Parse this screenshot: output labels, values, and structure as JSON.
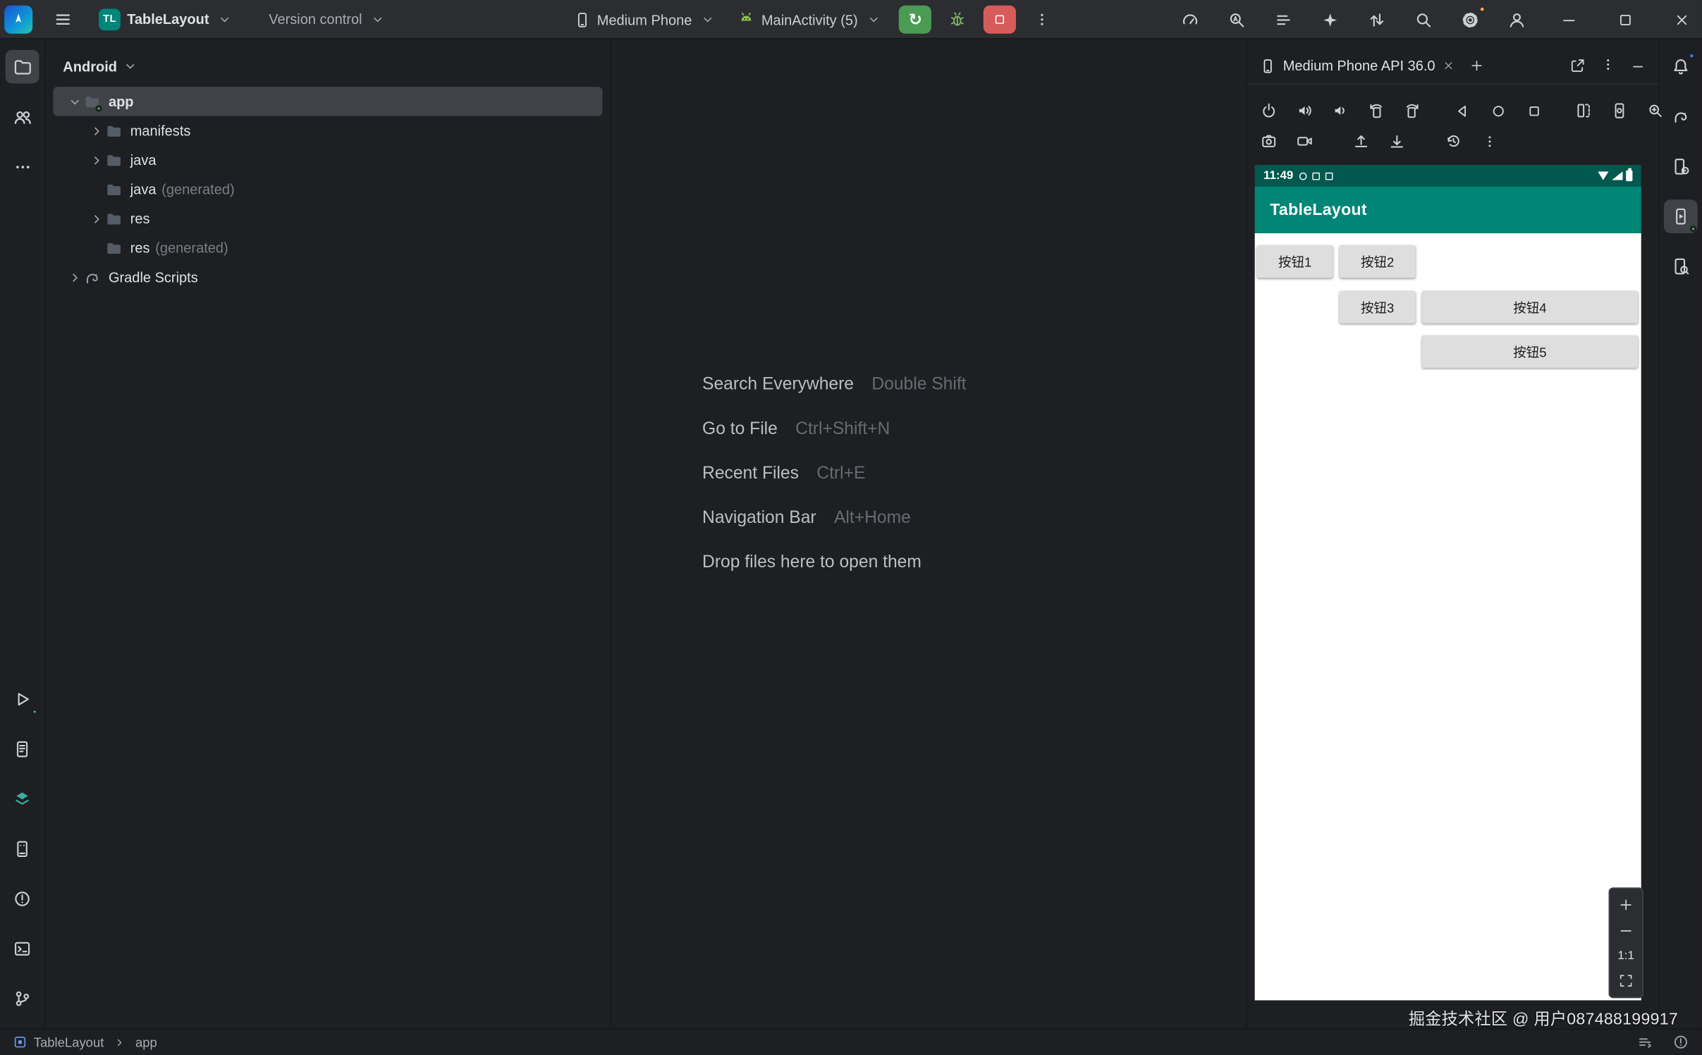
{
  "titlebar": {
    "project_abbr": "TL",
    "project_name": "TableLayout",
    "version_control_label": "Version control",
    "device_selector": "Medium Phone",
    "run_config": "MainActivity (5)"
  },
  "project_panel": {
    "view_selector": "Android",
    "items": [
      {
        "label": "app",
        "suffix": ""
      },
      {
        "label": "manifests",
        "suffix": ""
      },
      {
        "label": "java",
        "suffix": ""
      },
      {
        "label": "java",
        "suffix": "(generated)"
      },
      {
        "label": "res",
        "suffix": ""
      },
      {
        "label": "res",
        "suffix": "(generated)"
      },
      {
        "label": "Gradle Scripts",
        "suffix": ""
      }
    ]
  },
  "editor_shortcuts": [
    {
      "action": "Search Everywhere",
      "keys": "Double Shift"
    },
    {
      "action": "Go to File",
      "keys": "Ctrl+Shift+N"
    },
    {
      "action": "Recent Files",
      "keys": "Ctrl+E"
    },
    {
      "action": "Navigation Bar",
      "keys": "Alt+Home"
    },
    {
      "action": "Drop files here to open them",
      "keys": ""
    }
  ],
  "device_panel": {
    "tab_title": "Medium Phone API 36.0",
    "phone": {
      "status_time": "11:49",
      "app_title": "TableLayout",
      "buttons": [
        "按钮1",
        "按钮2",
        "按钮3",
        "按钮4",
        "按钮5"
      ]
    },
    "zoom_level": "1:1",
    "watermark": "掘金技术社区 @ 用户087488199917"
  },
  "status_bar": {
    "project": "TableLayout",
    "module": "app"
  },
  "colors": {
    "app_bar_teal": "#008577",
    "status_bar_teal": "#00584E",
    "run_green": "#4C9B54",
    "stop_red": "#D75B5B",
    "project_badge_teal": "#00857A",
    "selection_gray": "#3F4247",
    "notification_blue": "#3574F0",
    "notification_yellow": "#F0B43F",
    "running_dot_green": "#5FB865"
  },
  "icons": {
    "search": "magnifier",
    "settings": "gear",
    "account": "person-circle",
    "rerun": "circular-arrow",
    "debug": "bug",
    "stop": "square",
    "notifications": "bell",
    "gradle": "elephant",
    "nav_back": "triangle-left",
    "nav_home": "circle",
    "nav_overview": "square"
  }
}
